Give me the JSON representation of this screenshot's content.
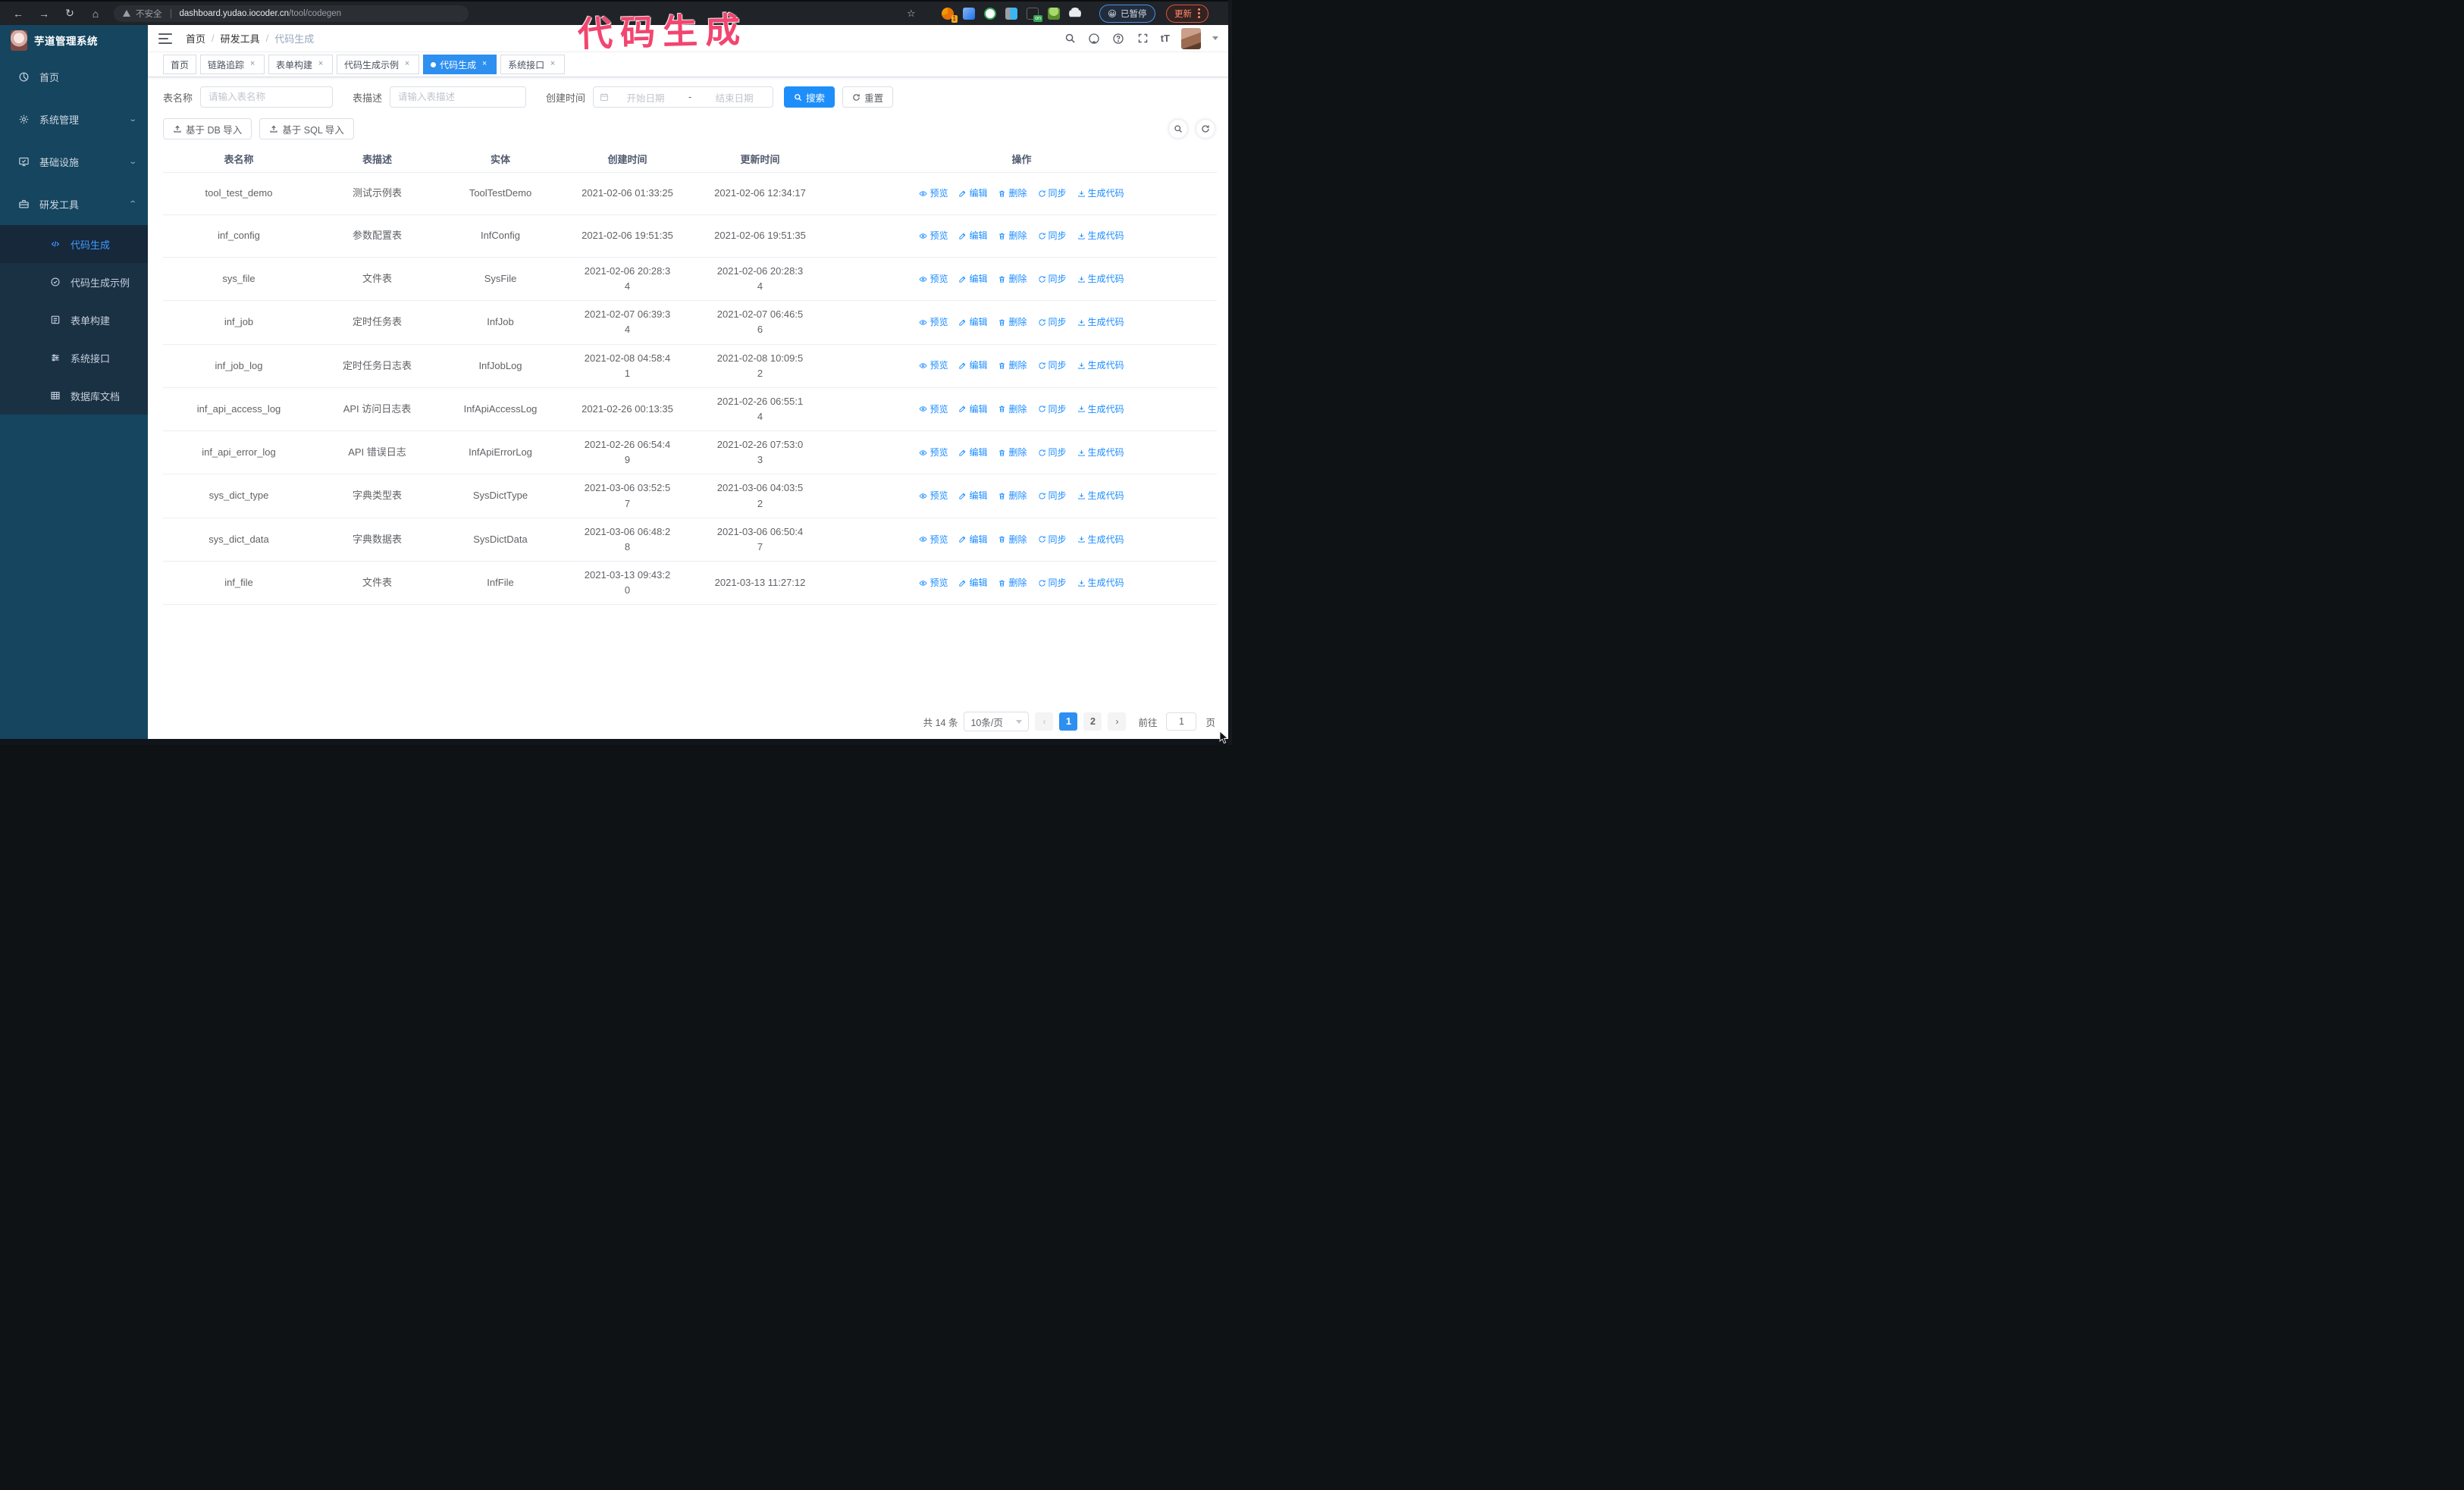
{
  "browser": {
    "security_label": "不安全",
    "url_domain": "dashboard.yudao.iocoder.cn",
    "url_path": "/tool/codegen",
    "extension_badge": "1",
    "on_badge": "on",
    "paused_label": "已暂停",
    "update_label": "更新"
  },
  "annotation": "代码生成",
  "sidebar": {
    "logo_title": "芋道管理系统",
    "items": [
      {
        "label": "首页",
        "icon": "dashboard-icon"
      },
      {
        "label": "系统管理",
        "icon": "gear-icon",
        "chevron": "down"
      },
      {
        "label": "基础设施",
        "icon": "monitor-icon",
        "chevron": "down"
      },
      {
        "label": "研发工具",
        "icon": "toolbox-icon",
        "chevron": "up"
      }
    ],
    "submenu": [
      {
        "label": "代码生成",
        "icon": "code-icon",
        "active": true
      },
      {
        "label": "代码生成示例",
        "icon": "badge-check-icon",
        "active": false
      },
      {
        "label": "表单构建",
        "icon": "form-icon",
        "active": false
      },
      {
        "label": "系统接口",
        "icon": "sliders-icon",
        "active": false
      },
      {
        "label": "数据库文档",
        "icon": "table-grid-icon",
        "active": false
      }
    ]
  },
  "navbar": {
    "breadcrumb": [
      "首页",
      "研发工具",
      "代码生成"
    ]
  },
  "tabs": [
    {
      "label": "首页",
      "closable": false,
      "active": false
    },
    {
      "label": "链路追踪",
      "closable": true,
      "active": false
    },
    {
      "label": "表单构建",
      "closable": true,
      "active": false
    },
    {
      "label": "代码生成示例",
      "closable": true,
      "active": false
    },
    {
      "label": "代码生成",
      "closable": true,
      "active": true
    },
    {
      "label": "系统接口",
      "closable": true,
      "active": false
    }
  ],
  "filters": {
    "name_label": "表名称",
    "name_placeholder": "请输入表名称",
    "desc_label": "表描述",
    "desc_placeholder": "请输入表描述",
    "time_label": "创建时间",
    "start_placeholder": "开始日期",
    "range_separator": "-",
    "end_placeholder": "结束日期",
    "search_label": "搜索",
    "reset_label": "重置"
  },
  "toolbar": {
    "db_import_label": "基于 DB 导入",
    "sql_import_label": "基于 SQL 导入"
  },
  "table": {
    "columns": [
      "表名称",
      "表描述",
      "实体",
      "创建时间",
      "更新时间",
      "操作"
    ],
    "action_labels": [
      "预览",
      "编辑",
      "删除",
      "同步",
      "生成代码"
    ],
    "rows": [
      {
        "name": "tool_test_demo",
        "desc": "测试示例表",
        "entity": "ToolTestDemo",
        "created": "2021-02-06 01:33:25",
        "updated": "2021-02-06 12:34:17"
      },
      {
        "name": "inf_config",
        "desc": "参数配置表",
        "entity": "InfConfig",
        "created": "2021-02-06 19:51:35",
        "updated": "2021-02-06 19:51:35"
      },
      {
        "name": "sys_file",
        "desc": "文件表",
        "entity": "SysFile",
        "created": "2021-02-06 20:28:3\n4",
        "updated": "2021-02-06 20:28:3\n4"
      },
      {
        "name": "inf_job",
        "desc": "定时任务表",
        "entity": "InfJob",
        "created": "2021-02-07 06:39:3\n4",
        "updated": "2021-02-07 06:46:5\n6"
      },
      {
        "name": "inf_job_log",
        "desc": "定时任务日志表",
        "entity": "InfJobLog",
        "created": "2021-02-08 04:58:4\n1",
        "updated": "2021-02-08 10:09:5\n2"
      },
      {
        "name": "inf_api_access_log",
        "desc": "API 访问日志表",
        "entity": "InfApiAccessLog",
        "created": "2021-02-26 00:13:35",
        "updated": "2021-02-26 06:55:1\n4"
      },
      {
        "name": "inf_api_error_log",
        "desc": "API 错误日志",
        "entity": "InfApiErrorLog",
        "created": "2021-02-26 06:54:4\n9",
        "updated": "2021-02-26 07:53:0\n3"
      },
      {
        "name": "sys_dict_type",
        "desc": "字典类型表",
        "entity": "SysDictType",
        "created": "2021-03-06 03:52:5\n7",
        "updated": "2021-03-06 04:03:5\n2"
      },
      {
        "name": "sys_dict_data",
        "desc": "字典数据表",
        "entity": "SysDictData",
        "created": "2021-03-06 06:48:2\n8",
        "updated": "2021-03-06 06:50:4\n7"
      },
      {
        "name": "inf_file",
        "desc": "文件表",
        "entity": "InfFile",
        "created": "2021-03-13 09:43:2\n0",
        "updated": "2021-03-13 11:27:12"
      }
    ]
  },
  "pagination": {
    "total_label": "共 14 条",
    "page_size_label": "10条/页",
    "pages": [
      "1",
      "2"
    ],
    "active_page": "1",
    "goto_label": "前往",
    "goto_value": "1",
    "page_unit_label": "页"
  }
}
